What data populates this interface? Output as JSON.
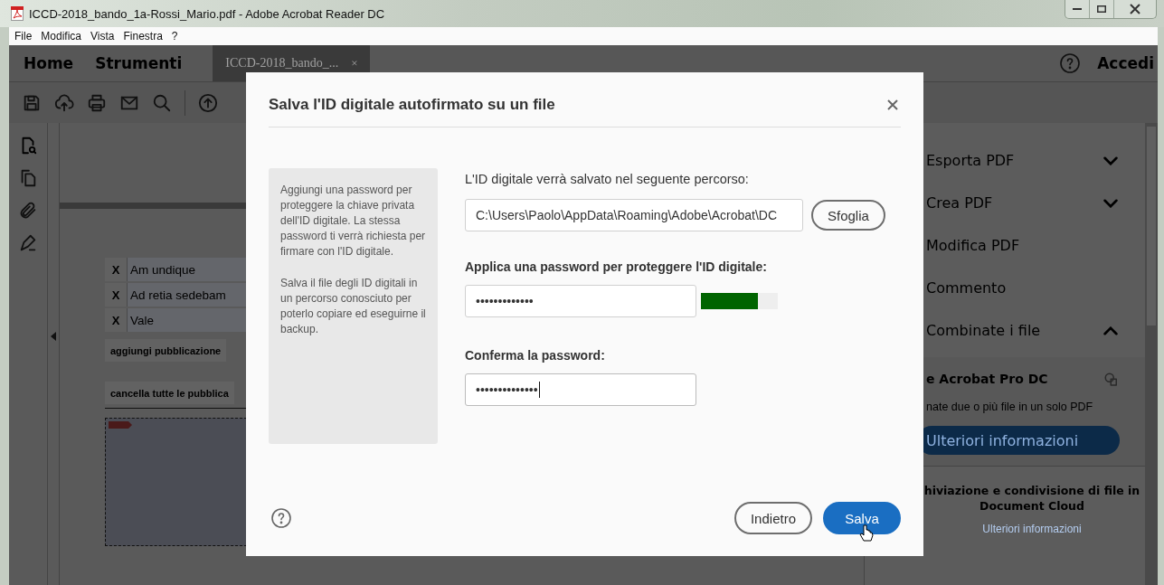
{
  "window": {
    "title": "ICCD-2018_bando_1a-Rossi_Mario.pdf - Adobe Acrobat Reader DC"
  },
  "menu": [
    {
      "label": "File"
    },
    {
      "label": "Modifica"
    },
    {
      "label": "Vista"
    },
    {
      "label": "Finestra"
    },
    {
      "label": "?"
    }
  ],
  "nav": {
    "tabs": [
      {
        "label": "Home",
        "selected": false
      },
      {
        "label": "Strumenti",
        "selected": false
      },
      {
        "label": "ICCD-2018_bando_...",
        "selected": true,
        "close": "×"
      }
    ],
    "sign_in": "Accedi"
  },
  "document": {
    "rows": [
      {
        "mark": "X",
        "label": "Am undique"
      },
      {
        "mark": "X",
        "label": "Ad retia sedebam"
      },
      {
        "mark": "X",
        "label": "Vale"
      }
    ],
    "add_button": "aggiungi pubblicazione",
    "clear_button": "cancella tutte le pubblica"
  },
  "tools_panel": {
    "items": [
      {
        "label": "Esporta PDF",
        "kind": "collapsible",
        "expanded": false
      },
      {
        "label": "Crea PDF",
        "kind": "collapsible",
        "expanded": false
      },
      {
        "label": "Modifica PDF",
        "kind": "plain"
      },
      {
        "label": "Commento",
        "kind": "plain"
      },
      {
        "label": "Combinate i file",
        "kind": "collapsible",
        "expanded": true
      }
    ],
    "promo": {
      "title": "e Acrobat Pro DC",
      "text": "nate due o più file in un solo PDF",
      "button": "Ulteriori informazioni"
    },
    "cloud": {
      "lines": [
        "hiviazione e condivisione di file in",
        "Document Cloud"
      ],
      "link": "Ulteriori informazioni"
    }
  },
  "dialog": {
    "title": "Salva l'ID digitale autofirmato su un file",
    "info": [
      "Aggiungi una password per proteggere la chiave privata dell'ID digitale. La stessa password ti verrà richiesta per firmare con l'ID digitale.",
      "Salva il file degli ID digitali in un percorso conosciuto per poterlo copiare ed eseguirne il backup."
    ],
    "path_label": "L'ID digitale verrà salvato nel seguente percorso:",
    "path_value": "C:\\Users\\Paolo\\AppData\\Roaming\\Adobe\\Acrobat\\DC",
    "browse_button": "Sfoglia",
    "password_label": "Applica una password per proteggere l'ID digitale:",
    "password_value": "•••••••••••••",
    "strength": {
      "level": 0.74
    },
    "confirm_label": "Conferma la password:",
    "confirm_value": "••••••••••••••",
    "confirm_focused": true,
    "buttons": [
      {
        "label": "Indietro",
        "kind": "secondary"
      },
      {
        "label": "Salva",
        "kind": "primary"
      }
    ]
  }
}
